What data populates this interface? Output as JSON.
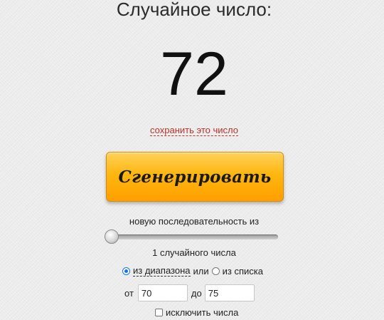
{
  "header": {
    "title": "Случайное число:"
  },
  "result": {
    "number": "72"
  },
  "save_link": "сохранить это число",
  "generate_button": "Сгенерировать",
  "sequence": {
    "label": "новую последовательность из",
    "count_label": "1 случайного числа",
    "slider_value": 1
  },
  "source": {
    "range_label": "из диапазона",
    "or_label": "или",
    "list_label": "из списка",
    "selected": "range"
  },
  "range": {
    "from_label": "от",
    "from_value": "70",
    "to_label": "до",
    "to_value": "75"
  },
  "exclude": {
    "label": "исключить числа",
    "checked": false
  },
  "colors": {
    "accent_link": "#b5342b",
    "button_orange": "#ffb60f",
    "radio_blue": "#1a73e8"
  }
}
